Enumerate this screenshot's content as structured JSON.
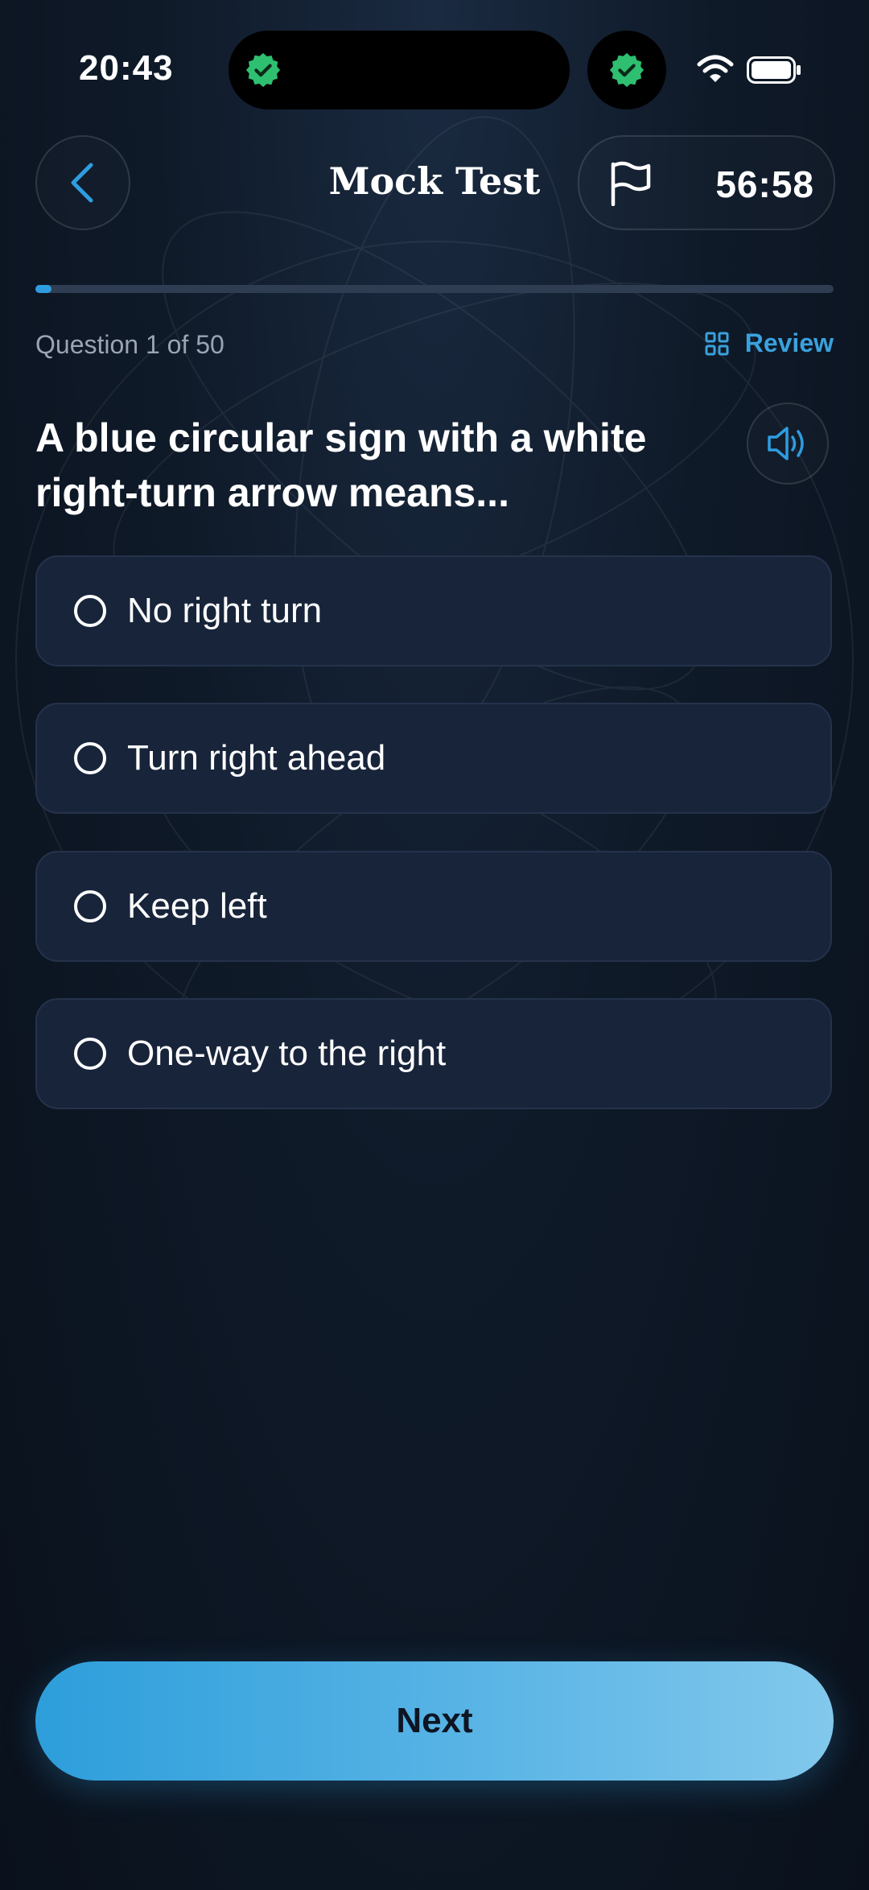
{
  "status_bar": {
    "time": "20:43",
    "badge_icon": "verified-badge-icon",
    "badge_color": "#2fbf71"
  },
  "header": {
    "back_icon": "chevron-left-icon",
    "title": "Mock Test",
    "flag_icon": "flag-icon",
    "timer": "56:58"
  },
  "progress": {
    "current": 1,
    "total": 50,
    "counter_text": "Question 1 of 50",
    "review_label": "Review",
    "review_icon": "grid-icon"
  },
  "question": {
    "text": "A blue circular sign with a white right-turn arrow means...",
    "audio_icon": "speaker-icon"
  },
  "options": [
    {
      "label": "No right turn",
      "selected": false
    },
    {
      "label": "Turn right ahead",
      "selected": false
    },
    {
      "label": "Keep left",
      "selected": false
    },
    {
      "label": "One-way to the right",
      "selected": false
    }
  ],
  "next_button": {
    "label": "Next"
  },
  "colors": {
    "accent": "#2f9ce0",
    "background": "#0f1a29",
    "option_bg": "#18243a"
  }
}
